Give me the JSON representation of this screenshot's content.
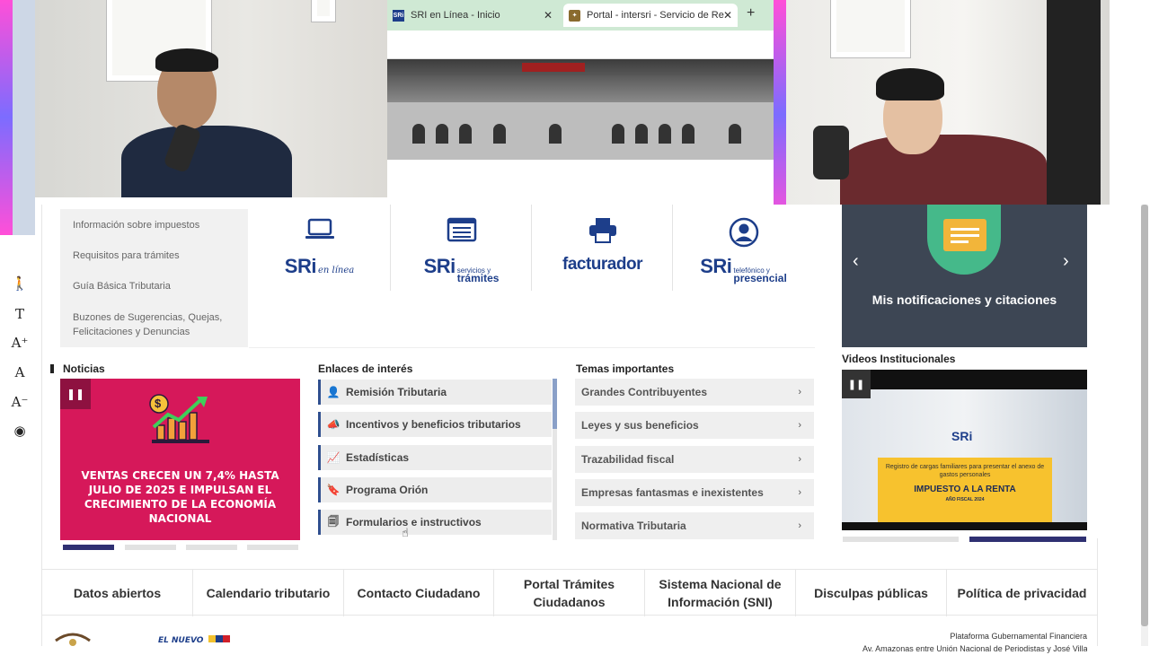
{
  "browser": {
    "tabs": [
      {
        "label": "SRI en Línea - Inicio",
        "favicon": "SRi"
      },
      {
        "label": "Portal - intersri - Servicio de Re",
        "favicon": "✦"
      }
    ],
    "close_glyph": "✕",
    "new_tab_glyph": "+"
  },
  "services_menu": {
    "items": [
      "Información sobre impuestos",
      "Requisitos para trámites",
      "Guía Básica Tributaria",
      "Buzones de Sugerencias, Quejas, Felicitaciones y Denuncias"
    ]
  },
  "quick_access": [
    {
      "icon": "laptop-icon",
      "logo_main": "SRi",
      "logo_sub": "en línea"
    },
    {
      "icon": "list-icon",
      "logo_main": "SRi",
      "logo_sub_top": "servicios y",
      "logo_sub_bottom": "trámites"
    },
    {
      "icon": "printer-icon",
      "logo_main": "facturador",
      "logo_sub": ""
    },
    {
      "icon": "user-icon",
      "logo_main": "SRi",
      "logo_sub_top": "telefónico y",
      "logo_sub_bottom": "presencial"
    }
  ],
  "notifications": {
    "title": "Mis notificaciones y citaciones",
    "prev": "‹",
    "next": "›"
  },
  "news": {
    "title": "Noticias",
    "pause": "❚❚",
    "headline": "VENTAS CRECEN UN 7,4% HASTA JULIO DE 2025 E IMPULSAN EL CRECIMIENTO DE LA ECONOMÍA NACIONAL",
    "coin_symbol": "$",
    "active_slide": 1,
    "slide_count": 4
  },
  "links_of_interest": {
    "title": "Enlaces de interés",
    "items": [
      {
        "label": "Remisión Tributaria",
        "icon": "person-icon",
        "glyph": "👤"
      },
      {
        "label": "Incentivos y beneficios tributarios",
        "icon": "megaphone-icon",
        "glyph": "📣"
      },
      {
        "label": "Estadísticas",
        "icon": "chart-icon",
        "glyph": "📈"
      },
      {
        "label": "Programa Orión",
        "icon": "bookmark-icon",
        "glyph": "🔖"
      },
      {
        "label": "Formularios e instructivos",
        "icon": "forms-icon",
        "glyph": "🗐"
      }
    ]
  },
  "topics": {
    "title": "Temas importantes",
    "items": [
      "Grandes Contribuyentes",
      "Leyes y sus beneficios",
      "Trazabilidad fiscal",
      "Empresas fantasmas e inexistentes",
      "Normativa Tributaria"
    ],
    "chevron": "›"
  },
  "videos": {
    "title": "Videos Institucionales",
    "pause": "❚❚",
    "brand": "SRi",
    "card_line1": "Registro de cargas familiares para presentar el anexo de gastos personales",
    "card_title": "IMPUESTO A LA RENTA",
    "card_sub": "AÑO FISCAL 2024"
  },
  "footer_links": [
    "Datos abiertos",
    "Calendario tributario",
    "Contacto Ciudadano",
    "Portal Trámites Ciudadanos",
    "Sistema Nacional de Información (SNI)",
    "Disculpas públicas",
    "Política de privacidad"
  ],
  "bottom": {
    "platform": "Plataforma Gubernamental Financiera",
    "address": "Av. Amazonas entre Unión Nacional de Periodistas y José Villalengua, Quito - Ecuador",
    "nuevo_logo": "EL NUEVO"
  },
  "accessibility": {
    "buttons": [
      {
        "name": "accessibility-person-icon",
        "glyph": "🚶"
      },
      {
        "name": "text-format-icon",
        "glyph": "T"
      },
      {
        "name": "font-increase-icon",
        "glyph": "A⁺"
      },
      {
        "name": "font-reset-icon",
        "glyph": "A"
      },
      {
        "name": "font-decrease-icon",
        "glyph": "A⁻"
      },
      {
        "name": "hide-eye-icon",
        "glyph": "◉"
      }
    ]
  },
  "colors": {
    "sri_blue": "#1d3e8a",
    "news_pink": "#d6185a",
    "notif_dark": "#3d4654",
    "notif_green": "#45b98a",
    "notif_yellow": "#f2b53a",
    "slide_active": "#2f3072"
  }
}
